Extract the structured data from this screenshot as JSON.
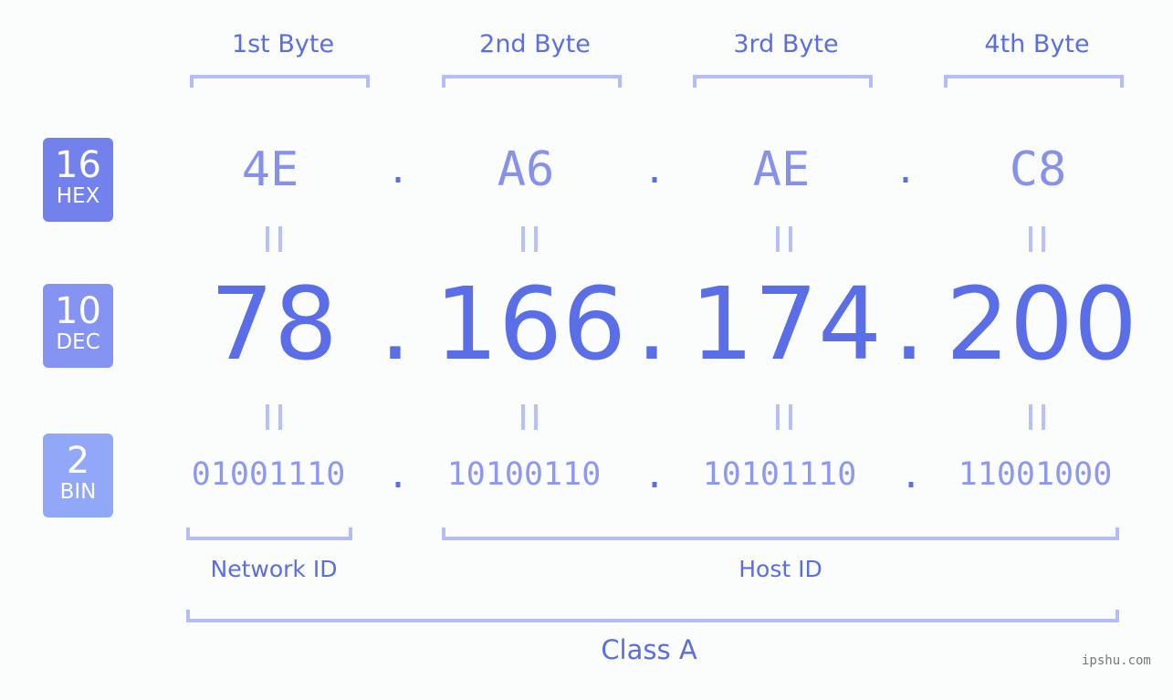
{
  "bytes": {
    "labels": [
      "1st Byte",
      "2nd Byte",
      "3rd Byte",
      "4th Byte"
    ]
  },
  "badges": {
    "hex": {
      "num": "16",
      "label": "HEX",
      "color": "#7381ec"
    },
    "dec": {
      "num": "10",
      "label": "DEC",
      "color": "#8593f2"
    },
    "bin": {
      "num": "2",
      "label": "BIN",
      "color": "#91a8f8"
    }
  },
  "hex": [
    "4E",
    "A6",
    "AE",
    "C8"
  ],
  "dec": [
    "78",
    "166",
    "174",
    "200"
  ],
  "bin": [
    "01001110",
    "10100110",
    "10101110",
    "11001000"
  ],
  "separator": ".",
  "segments": {
    "network": "Network ID",
    "host": "Host ID",
    "class": "Class A"
  },
  "watermark": "ipshu.com"
}
